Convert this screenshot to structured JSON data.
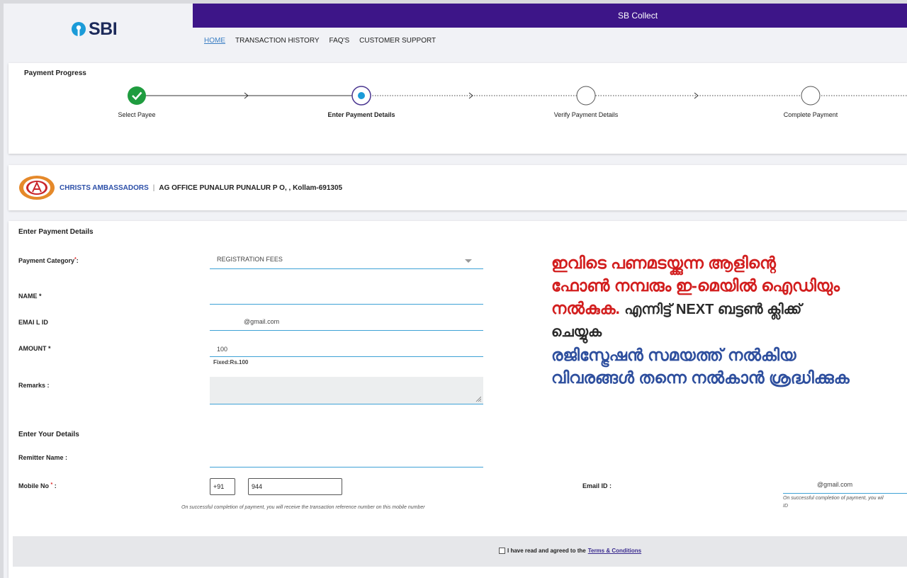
{
  "header": {
    "logo_text": "SBI",
    "app_title": "SB Collect",
    "nav": [
      "HOME",
      "TRANSACTION HISTORY",
      "FAQ'S",
      "CUSTOMER SUPPORT"
    ]
  },
  "progress": {
    "title": "Payment Progress",
    "steps": [
      {
        "label": "Select Payee",
        "state": "done"
      },
      {
        "label": "Enter Payment Details",
        "state": "current"
      },
      {
        "label": "Verify Payment Details",
        "state": "pending"
      },
      {
        "label": "Complete Payment",
        "state": "pending"
      }
    ]
  },
  "payee": {
    "name": "CHRISTS AMBASSADORS",
    "separator": "|",
    "address": "AG OFFICE PUNALUR PUNALUR P O, , Kollam-691305"
  },
  "payment": {
    "section_title": "Enter Payment Details",
    "category_label": "Payment Category",
    "category_value": "REGISTRATION FEES",
    "name_label": "NAME *",
    "name_value": "",
    "email_label": "EMAI L ID",
    "email_value": "@gmail.com",
    "amount_label": "AMOUNT *",
    "amount_value": "100",
    "fixed_note": "Fixed:Rs.100",
    "remarks_label": "Remarks :"
  },
  "your_details": {
    "section_title": "Enter Your Details",
    "remitter_label": "Remitter Name :",
    "remitter_value": "",
    "mobile_label": "Mobile No",
    "country_code": "+91",
    "mobile_value": "944",
    "mobile_hint": "On successful completion of payment, you will receive the transaction reference number on this mobile number",
    "email_label": "Email ID :",
    "email_value": "@gmail.com",
    "email_hint_1": "On successful completion of payment, you wil",
    "email_hint_2": "ID"
  },
  "overlay": {
    "line1": "ഇവിടെ പണമടയ്ക്കുന്ന ആളിന്റെ",
    "line2": "ഫോൺ നമ്പരും ഇ-മെയിൽ ഐഡിയും",
    "line3_red": "നൽകുക.",
    "line3_dark": "എന്നിട്ട് NEXT ബട്ടൺ ക്ലിക്ക്",
    "line4": "ചെയ്യുക",
    "line5": "രജിസ്ട്രേഷൻ സമയത്ത് നൽകിയ",
    "line6": "വിവരങ്ങൾ തന്നെ നൽകാൻ ശ്രദ്ധിക്കുക"
  },
  "terms": {
    "text": "I have read and agreed to the",
    "link": "Terms & Conditions"
  }
}
